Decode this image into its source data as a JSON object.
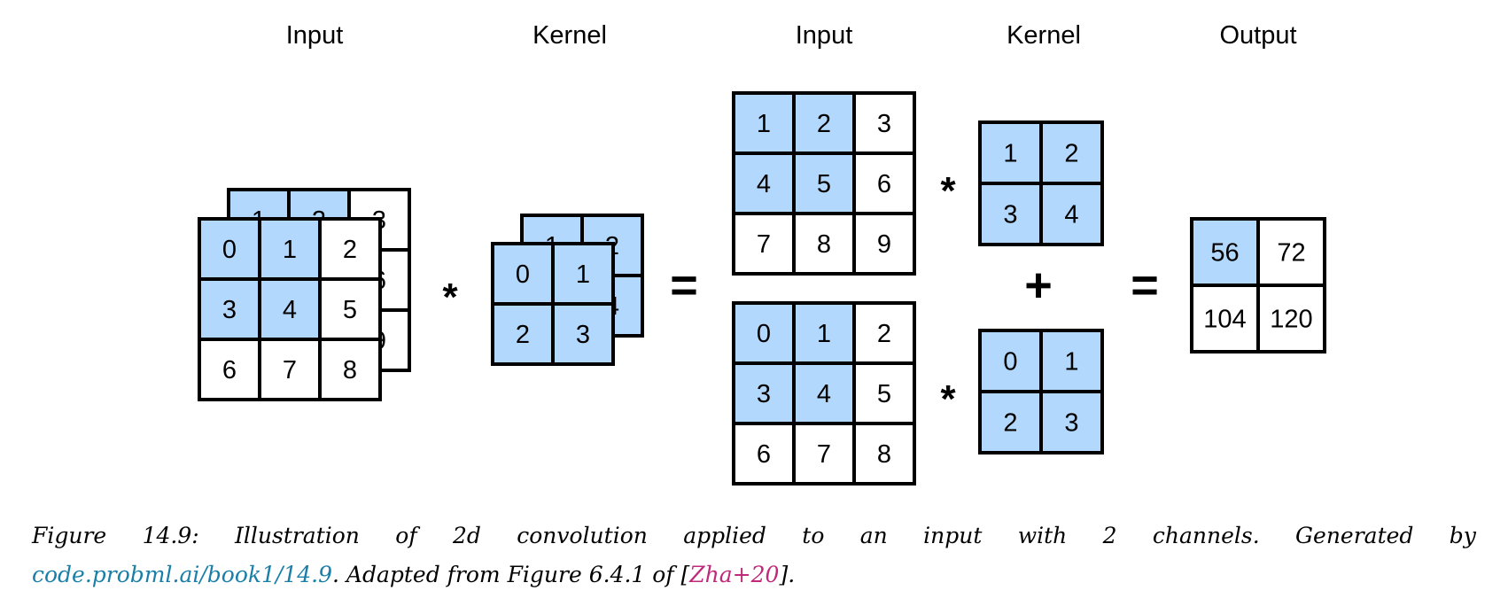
{
  "labels": {
    "input_left": "Input",
    "kernel_left": "Kernel",
    "input_right": "Input",
    "kernel_right": "Kernel",
    "output": "Output"
  },
  "operators": {
    "conv": "*",
    "equals": "=",
    "plus": "+"
  },
  "colors": {
    "highlight": "#b3d8fd",
    "border": "#000000",
    "link": "#1a7fa8",
    "citation": "#c0287a"
  },
  "grids": {
    "input_ch1": {
      "values": [
        [
          1,
          2,
          3
        ],
        [
          4,
          5,
          6
        ],
        [
          7,
          8,
          9
        ]
      ],
      "highlight": [
        [
          1,
          1,
          0
        ],
        [
          1,
          1,
          0
        ],
        [
          0,
          0,
          0
        ]
      ]
    },
    "input_ch0": {
      "values": [
        [
          0,
          1,
          2
        ],
        [
          3,
          4,
          5
        ],
        [
          6,
          7,
          8
        ]
      ],
      "highlight": [
        [
          1,
          1,
          0
        ],
        [
          1,
          1,
          0
        ],
        [
          0,
          0,
          0
        ]
      ]
    },
    "kernel_ch1": {
      "values": [
        [
          1,
          2
        ],
        [
          3,
          4
        ]
      ],
      "highlight": [
        [
          1,
          1
        ],
        [
          1,
          1
        ]
      ]
    },
    "kernel_ch0": {
      "values": [
        [
          0,
          1
        ],
        [
          2,
          3
        ]
      ],
      "highlight": [
        [
          1,
          1
        ],
        [
          1,
          1
        ]
      ]
    },
    "output": {
      "values": [
        [
          56,
          72
        ],
        [
          104,
          120
        ]
      ],
      "highlight": [
        [
          1,
          0
        ],
        [
          0,
          0
        ]
      ]
    }
  },
  "caption": {
    "line1_words": [
      "Figure",
      "14.9:",
      "Illustration",
      "of",
      "2d",
      "convolution",
      "applied",
      "to",
      "an",
      "input",
      "with",
      "2",
      "channels.",
      "Generated",
      "by"
    ],
    "link": "code.probml.ai/book1/14.9",
    "middle": ". Adapted from Figure 6.4.1 of [",
    "citation": "Zha+20",
    "end": "]."
  }
}
